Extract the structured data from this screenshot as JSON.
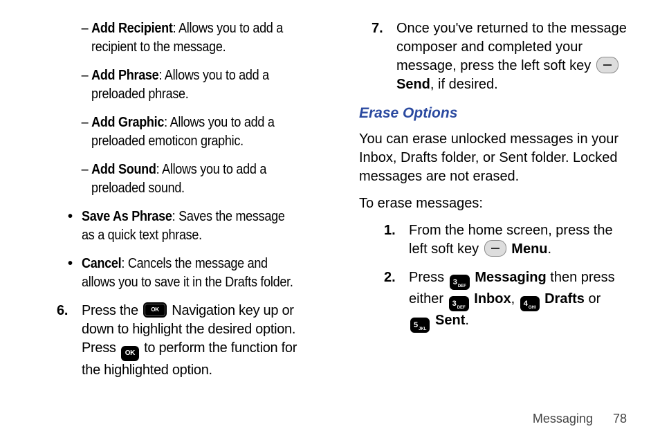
{
  "col1": {
    "addRecipient": {
      "term": "Add Recipient",
      "desc": ": Allows you to add a recipient to the message."
    },
    "addPhrase": {
      "term": "Add Phrase",
      "desc": ": Allows you to add a preloaded phrase."
    },
    "addGraphic": {
      "term": "Add Graphic",
      "desc": ": Allows you to add a preloaded emoticon graphic."
    },
    "addSound": {
      "term": "Add Sound",
      "desc": ": Allows you to add a preloaded sound."
    },
    "savePhrase": {
      "term": "Save As Phrase",
      "desc": ": Saves the message as a quick text phrase."
    },
    "cancel": {
      "term": "Cancel",
      "desc": ": Cancels the message and allows you to save it in the Drafts folder."
    },
    "step6": {
      "num": "6.",
      "part1": "Press the ",
      "part2": " Navigation key up or down to highlight the desired option. Press ",
      "part3": " to perform the function for the highlighted option."
    }
  },
  "col2": {
    "step7": {
      "num": "7.",
      "part1": "Once you've returned to the message composer and completed your message, press the left soft key ",
      "bold": "Send",
      "part2": ", if desired."
    },
    "eraseHeading": "Erase Options",
    "erasePara1": "You can erase unlocked messages in your Inbox, Drafts folder, or Sent folder. Locked messages are not erased.",
    "erasePara2": "To erase messages:",
    "estep1": {
      "num": "1.",
      "part1": "From the home screen, press the left soft key ",
      "bold": "Menu",
      "part2": "."
    },
    "estep2": {
      "num": "2.",
      "p1": "Press ",
      "b1": "Messaging",
      "p2": " then press either ",
      "b2": "Inbox",
      "p3": ", ",
      "b3": "Drafts",
      "p4": " or ",
      "b4": "Sent",
      "p5": "."
    }
  },
  "keys": {
    "ok": "OK",
    "k3": "3",
    "k3sub": "DEF",
    "k4": "4",
    "k4sub": "GHI",
    "k5": "5",
    "k5sub": "JKL"
  },
  "footer": {
    "section": "Messaging",
    "page": "78"
  }
}
